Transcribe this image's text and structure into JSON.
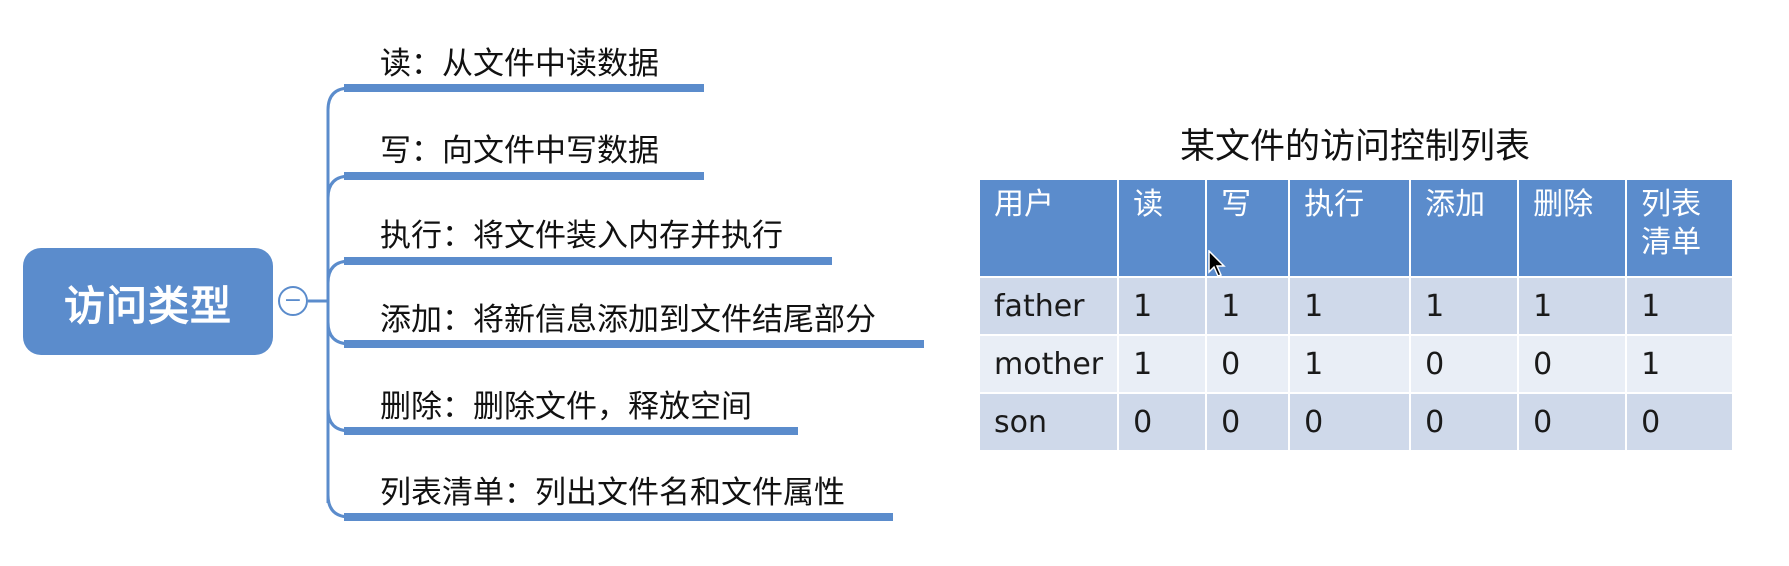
{
  "mindmap": {
    "root": "访问类型",
    "toggle_symbol": "−",
    "branches": [
      "读：从文件中读数据",
      "写：向文件中写数据",
      "执行：将文件装入内存并执行",
      "添加：将新信息添加到文件结尾部分",
      "删除：删除文件，释放空间",
      "列表清单：列出文件名和文件属性"
    ],
    "colors": {
      "node": "#5b8ccc",
      "line": "#5b8ccc"
    }
  },
  "table": {
    "title": "某文件的访问控制列表",
    "headers": [
      "用户",
      "读",
      "写",
      "执行",
      "添加",
      "删除",
      "列表\n清单"
    ],
    "rows": [
      [
        "father",
        "1",
        "1",
        "1",
        "1",
        "1",
        "1"
      ],
      [
        "mother",
        "1",
        "0",
        "1",
        "0",
        "0",
        "1"
      ],
      [
        "son",
        "0",
        "0",
        "0",
        "0",
        "0",
        "0"
      ]
    ],
    "colors": {
      "header": "#5b8ccc",
      "row_odd": "#cfd9ea",
      "row_even": "#e9eef6"
    }
  }
}
